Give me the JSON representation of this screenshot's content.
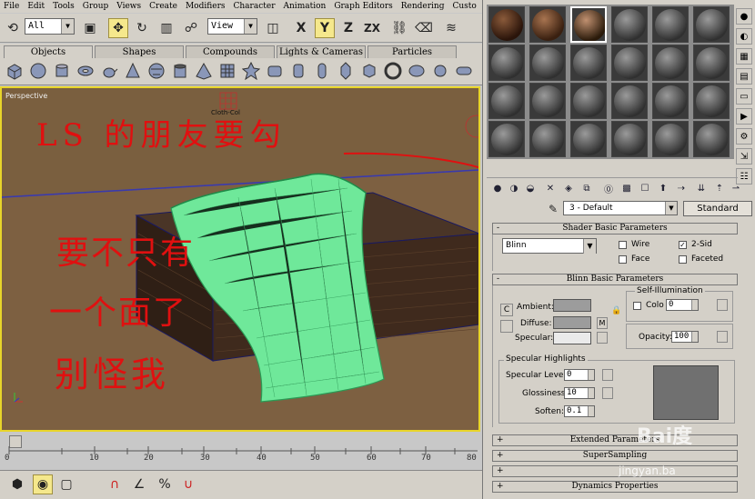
{
  "menu": [
    "File",
    "Edit",
    "Tools",
    "Group",
    "Views",
    "Create",
    "Modifiers",
    "Character",
    "Animation",
    "Graph Editors",
    "Rendering",
    "Custo"
  ],
  "toolbar": {
    "selection_filter": "All",
    "ref_coord": "View",
    "icons": [
      "undo-icon",
      "select-icon",
      "move-icon",
      "rotate-icon",
      "scale-icon",
      "x-axis-icon",
      "y-axis-icon",
      "z-axis-icon",
      "zx-plane-icon",
      "mirror-icon",
      "align-icon"
    ],
    "axis_x": "X",
    "axis_y": "Y",
    "axis_z": "Z",
    "axis_zx": "ZX"
  },
  "create_tabs": [
    "Objects",
    "Shapes",
    "Compounds",
    "Lights & Cameras",
    "Particles"
  ],
  "viewport": {
    "label": "Perspective",
    "object_label": "Cloth-Col",
    "annotation_line1": "LS 的朋友要勾",
    "annotation_line2": "要不只有",
    "annotation_line3": "一个面了",
    "annotation_line4": "别怪我",
    "annotation_color": "#e01010"
  },
  "timeline": {
    "ticks": [
      "0",
      "10",
      "20",
      "30",
      "40",
      "50",
      "60",
      "70",
      "80"
    ]
  },
  "material_editor": {
    "material_name": "3 - Default",
    "material_type": "Standard",
    "shader_rollout": "Shader Basic Parameters",
    "shader": "Blinn",
    "wire_label": "Wire",
    "two_sided_label": "2-Sid",
    "face_label": "Face",
    "faceted_label": "Faceted",
    "wire_checked": false,
    "two_sided_checked": true,
    "face_checked": false,
    "faceted_checked": false,
    "blinn_rollout": "Blinn Basic Parameters",
    "self_illum_title": "Self-Illumination",
    "color_label": "Colo",
    "self_illum_value": "0",
    "ambient_label": "Ambient:",
    "diffuse_label": "Diffuse:",
    "specular_label": "Specular:",
    "lock_label": "M",
    "c_label": "C",
    "opacity_label": "Opacity:",
    "opacity_value": "100",
    "spec_highlights_title": "Specular Highlights",
    "specular_level_label": "Specular Level:",
    "specular_level_value": "0",
    "glossiness_label": "Glossiness:",
    "glossiness_value": "10",
    "soften_label": "Soften:",
    "soften_value": "0.1",
    "extended_rollout": "Extended Parameters",
    "supersampling_rollout": "SuperSampling",
    "maps_rollout": "",
    "dynamics_rollout": "Dynamics Properties",
    "ambient_color": "#9c9c9c",
    "diffuse_color": "#9c9c9c",
    "specular_color": "#eaeaea"
  },
  "watermark": {
    "brand": "Bai度",
    "site": "jingyan.ba"
  }
}
